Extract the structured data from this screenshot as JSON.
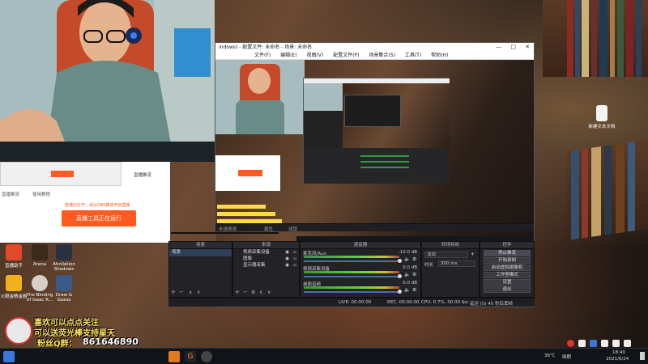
{
  "obs": {
    "title": "indows) - 配置文件: 未命名 - 场景: 未命名",
    "menu": [
      "文件(F)",
      "编辑(E)",
      "视图(V)",
      "配置文件(P)",
      "场景集合(S)",
      "工具(T)",
      "帮助(H)"
    ],
    "panels": {
      "scenes": "场景",
      "sources": "来源",
      "mixer": "混音器",
      "transitions": "转场特效",
      "controls": "控件"
    },
    "scene_item": "场景",
    "sources": [
      {
        "name": "视频采集设备"
      },
      {
        "name": "图像"
      },
      {
        "name": "显示器采集"
      }
    ],
    "mixer_channels": [
      {
        "name": "麦克风/Aux",
        "db": "-10.0 dB"
      },
      {
        "name": "视频采集设备",
        "db": "0.0 dB"
      },
      {
        "name": "桌面音频",
        "db": "0.0 dB"
      }
    ],
    "transition": {
      "fade_label": "淡出",
      "duration_label": "时长",
      "duration_value": "300 ms"
    },
    "controls": [
      "停止推流",
      "开始录制",
      "启动虚拟摄像机",
      "工作室模式",
      "设置",
      "退出"
    ],
    "statusbar": {
      "live": "LIVE: 00:00:00",
      "rec": "REC: 00:00:00",
      "cpu": "CPU: 0.7%, 30.00 fps",
      "dropped": "延迟 (5) 45 秒后丢帧"
    },
    "no_source": "未选择源",
    "properties": "属性",
    "filters": "滤镜"
  },
  "streamer_tool": {
    "info_text": "直播已打开，请从OBS推流开始直播",
    "status_button": "直播工具正在运行",
    "nav_left": "直播推流",
    "nav_right": "使用教程",
    "top_label": "直播推流"
  },
  "desktop": {
    "icons": [
      {
        "label": "直播助手"
      },
      {
        "label": "Arena"
      },
      {
        "label": "Ahnilation Shadows"
      },
      {
        "label": "火眼金睛金融"
      },
      {
        "label": "The Binding of Isaac R..."
      },
      {
        "label": "Draw & Guess"
      },
      {
        "label": "新建文本文档"
      }
    ]
  },
  "overlay": {
    "line1": "喜欢可以点点关注",
    "line2": "可以送荧光棒支持星天",
    "qq_label": "粉丝Q群：",
    "qq_number": "861646890"
  },
  "tray": {
    "temperature": "36℃",
    "weather": "晴朗",
    "time": "18:40",
    "date": "2021/6/24"
  },
  "colors": {
    "accent_orange": "#ff5a1f",
    "obs_bg": "#1f1f23",
    "meter_green": "#2e9a3e"
  }
}
